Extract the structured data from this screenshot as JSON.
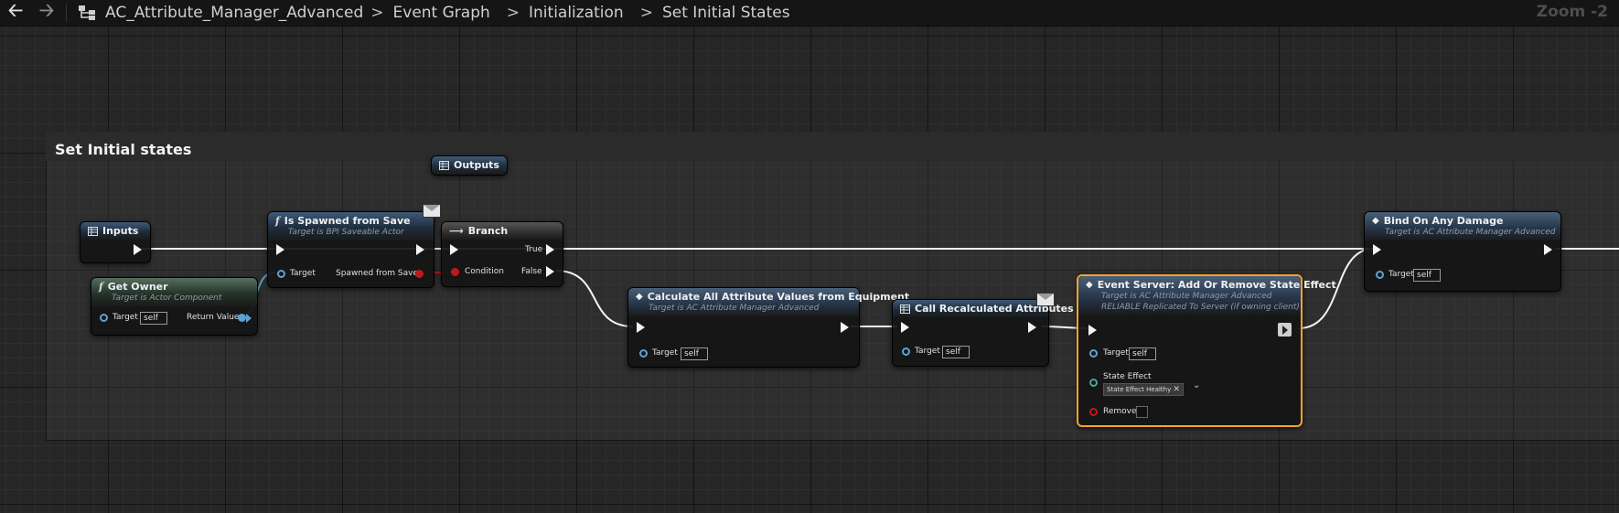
{
  "topbar": {
    "back_icon": "arrow-left-icon",
    "forward_icon": "arrow-right-icon",
    "hierarchy_icon": "graph-hierarchy-icon",
    "breadcrumbs": [
      "AC_Attribute_Manager_Advanced",
      "Event Graph",
      "Initialization",
      "Set Initial States"
    ],
    "zoom": "Zoom -2"
  },
  "comment": {
    "title": "Set Initial states"
  },
  "nodes": {
    "outputs": {
      "title": "Outputs"
    },
    "inputs": {
      "title": "Inputs"
    },
    "get_owner": {
      "title": "Get Owner",
      "subtitle": "Target is Actor Component",
      "target_label": "Target",
      "target_value": "self",
      "return_label": "Return Value"
    },
    "is_spawned": {
      "title": "Is Spawned from Save",
      "subtitle": "Target is BPI Saveable Actor",
      "target_label": "Target",
      "out_label": "Spawned from Save"
    },
    "branch": {
      "title": "Branch",
      "condition_label": "Condition",
      "true_label": "True",
      "false_label": "False"
    },
    "calc_all": {
      "title": "Calculate All Attribute Values from Equipment",
      "subtitle": "Target is AC Attribute Manager Advanced",
      "target_label": "Target",
      "target_value": "self"
    },
    "call_recalc": {
      "title": "Call Recalculated Attributes",
      "target_label": "Target",
      "target_value": "self"
    },
    "event_server": {
      "title": "Event Server: Add Or Remove State Effect",
      "subtitle1": "Target is AC Attribute Manager Advanced",
      "subtitle2": "RELIABLE Replicated To Server (if owning client)",
      "target_label": "Target",
      "target_value": "self",
      "state_effect_label": "State Effect",
      "state_effect_value": "State Effect Healthy",
      "remove_label": "Remove"
    },
    "bind_damage": {
      "title": "Bind On Any Damage",
      "subtitle": "Target is AC Attribute Manager Advanced",
      "target_label": "Target",
      "target_value": "self"
    }
  }
}
